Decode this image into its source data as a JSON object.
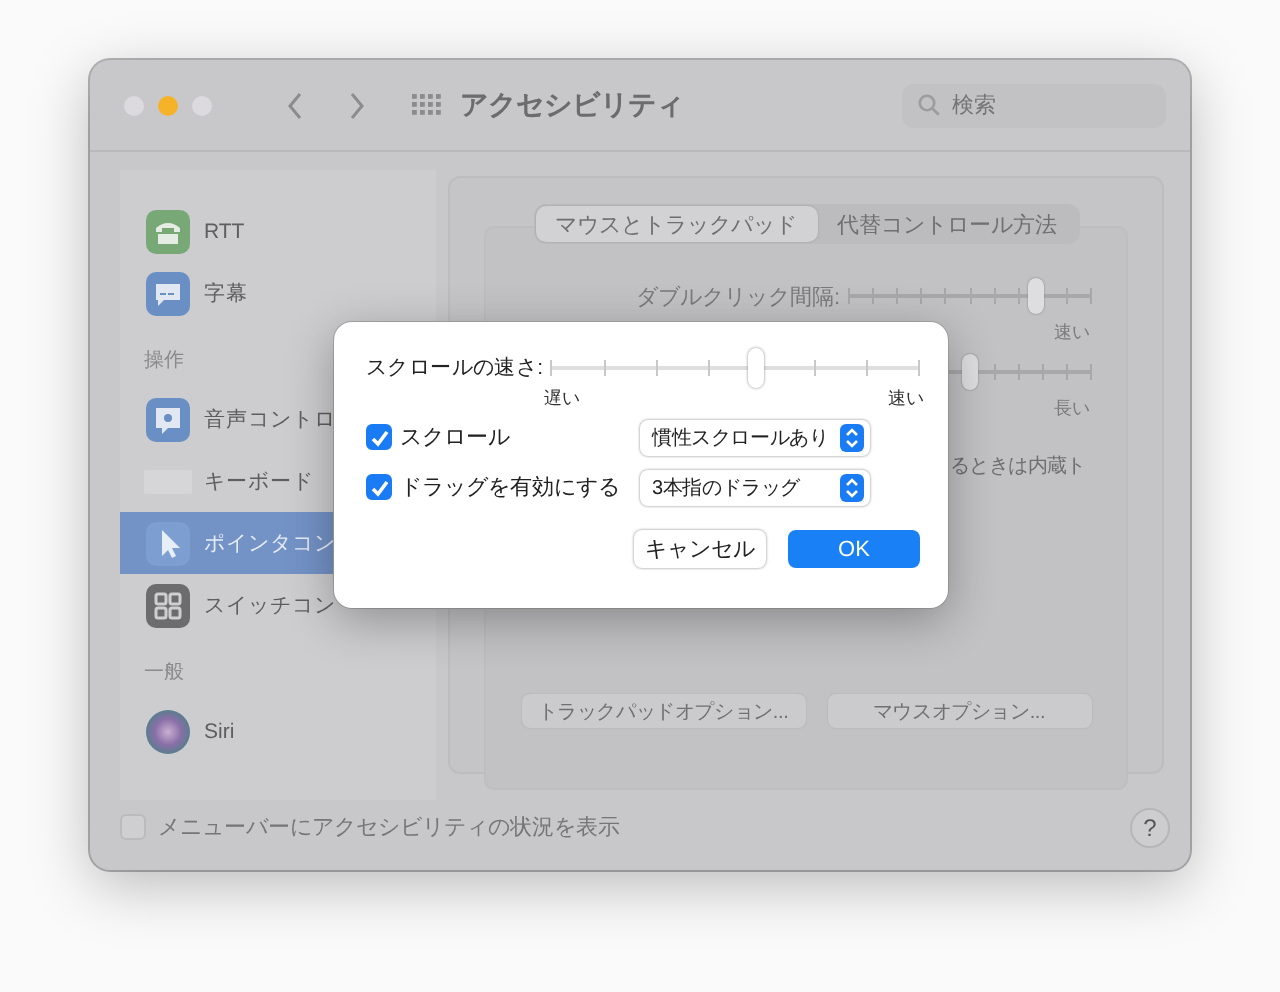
{
  "window": {
    "title": "アクセシビリティ",
    "search": {
      "placeholder": "検索"
    }
  },
  "sidebar": {
    "items": [
      {
        "kind": "item",
        "label": "RTT",
        "selected": false
      },
      {
        "kind": "item",
        "label": "字幕",
        "selected": false
      },
      {
        "kind": "header",
        "label": "操作"
      },
      {
        "kind": "item",
        "label": "音声コントロ",
        "selected": false
      },
      {
        "kind": "item",
        "label": "キーボード",
        "selected": false
      },
      {
        "kind": "item",
        "label": "ポインタコン",
        "selected": true
      },
      {
        "kind": "item",
        "label": "スイッチコン",
        "selected": false
      },
      {
        "kind": "header",
        "label": "一般"
      },
      {
        "kind": "item",
        "label": "Siri",
        "selected": false
      }
    ]
  },
  "main": {
    "tabs": [
      {
        "label": "マウスとトラックパッド",
        "selected": true
      },
      {
        "label": "代替コントロール方法",
        "selected": false
      }
    ],
    "sliders": [
      {
        "label": "ダブルクリック間隔:",
        "level": 0.78,
        "max_label": "速い"
      },
      {
        "level": 0.5,
        "max_label": "長い"
      }
    ],
    "note": "るときは内蔵ト",
    "buttons": [
      "トラックパッドオプション...",
      "マウスオプション..."
    ]
  },
  "sheet": {
    "speed": {
      "label": "スクロールの速さ:",
      "level": 0.56,
      "min_label": "遅い",
      "max_label": "速い"
    },
    "options": [
      {
        "label": "スクロール",
        "checked": true,
        "value": "慣性スクロールあり"
      },
      {
        "label": "ドラッグを有効にする",
        "checked": true,
        "value": "3本指のドラッグ"
      }
    ],
    "buttons": [
      {
        "label": "キャンセル",
        "kind": "secondary"
      },
      {
        "label": "OK",
        "kind": "default"
      }
    ]
  },
  "footer": {
    "label": "メニューバーにアクセシビリティの状況を表示",
    "checked": false,
    "help": "?"
  }
}
